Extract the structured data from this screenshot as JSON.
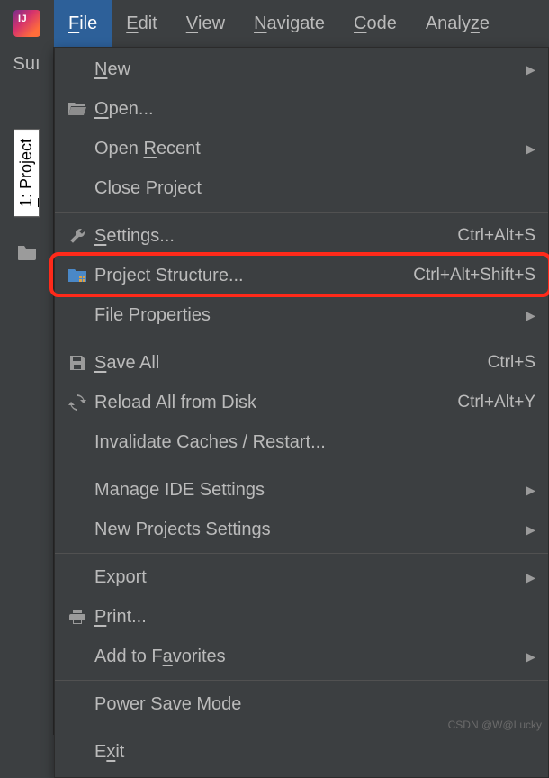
{
  "menubar": {
    "items": [
      {
        "label": "File",
        "mnemonic_index": 0
      },
      {
        "label": "Edit",
        "mnemonic_index": 0
      },
      {
        "label": "View",
        "mnemonic_index": 0
      },
      {
        "label": "Navigate",
        "mnemonic_index": 0
      },
      {
        "label": "Code",
        "mnemonic_index": 0
      },
      {
        "label": "Analyze",
        "mnemonic_index": 5
      }
    ],
    "active_index": 0
  },
  "app_icon_text": "IJ",
  "left_panel": {
    "partial_text": "Suı",
    "vertical_tab_label": "1: Project",
    "vertical_tab_mnemonic_index": 0
  },
  "file_menu": {
    "groups": [
      [
        {
          "label": "New",
          "mnemonic_index": 0,
          "icon": null,
          "submenu": true,
          "shortcut": null
        },
        {
          "label": "Open...",
          "mnemonic_index": 0,
          "icon": "open",
          "submenu": false,
          "shortcut": null
        },
        {
          "label": "Open Recent",
          "mnemonic_index": 5,
          "icon": null,
          "submenu": true,
          "shortcut": null
        },
        {
          "label": "Close Project",
          "mnemonic_index": null,
          "icon": null,
          "submenu": false,
          "shortcut": null
        }
      ],
      [
        {
          "label": "Settings...",
          "mnemonic_index": 0,
          "icon": "wrench",
          "submenu": false,
          "shortcut": "Ctrl+Alt+S"
        },
        {
          "label": "Project Structure...",
          "mnemonic_index": null,
          "icon": "structure",
          "submenu": false,
          "shortcut": "Ctrl+Alt+Shift+S",
          "highlight": true
        },
        {
          "label": "File Properties",
          "mnemonic_index": null,
          "icon": null,
          "submenu": true,
          "shortcut": null
        }
      ],
      [
        {
          "label": "Save All",
          "mnemonic_index": 0,
          "icon": "save",
          "submenu": false,
          "shortcut": "Ctrl+S"
        },
        {
          "label": "Reload All from Disk",
          "mnemonic_index": null,
          "icon": "reload",
          "submenu": false,
          "shortcut": "Ctrl+Alt+Y"
        },
        {
          "label": "Invalidate Caches / Restart...",
          "mnemonic_index": null,
          "icon": null,
          "submenu": false,
          "shortcut": null
        }
      ],
      [
        {
          "label": "Manage IDE Settings",
          "mnemonic_index": null,
          "icon": null,
          "submenu": true,
          "shortcut": null
        },
        {
          "label": "New Projects Settings",
          "mnemonic_index": null,
          "icon": null,
          "submenu": true,
          "shortcut": null
        }
      ],
      [
        {
          "label": "Export",
          "mnemonic_index": null,
          "icon": null,
          "submenu": true,
          "shortcut": null
        },
        {
          "label": "Print...",
          "mnemonic_index": 0,
          "icon": "print",
          "submenu": false,
          "shortcut": null
        },
        {
          "label": "Add to Favorites",
          "mnemonic_index": 8,
          "icon": null,
          "submenu": true,
          "shortcut": null
        }
      ],
      [
        {
          "label": "Power Save Mode",
          "mnemonic_index": null,
          "icon": null,
          "submenu": false,
          "shortcut": null
        }
      ],
      [
        {
          "label": "Exit",
          "mnemonic_index": 1,
          "icon": null,
          "submenu": false,
          "shortcut": null
        }
      ]
    ]
  },
  "watermark": "CSDN @W@Lucky"
}
